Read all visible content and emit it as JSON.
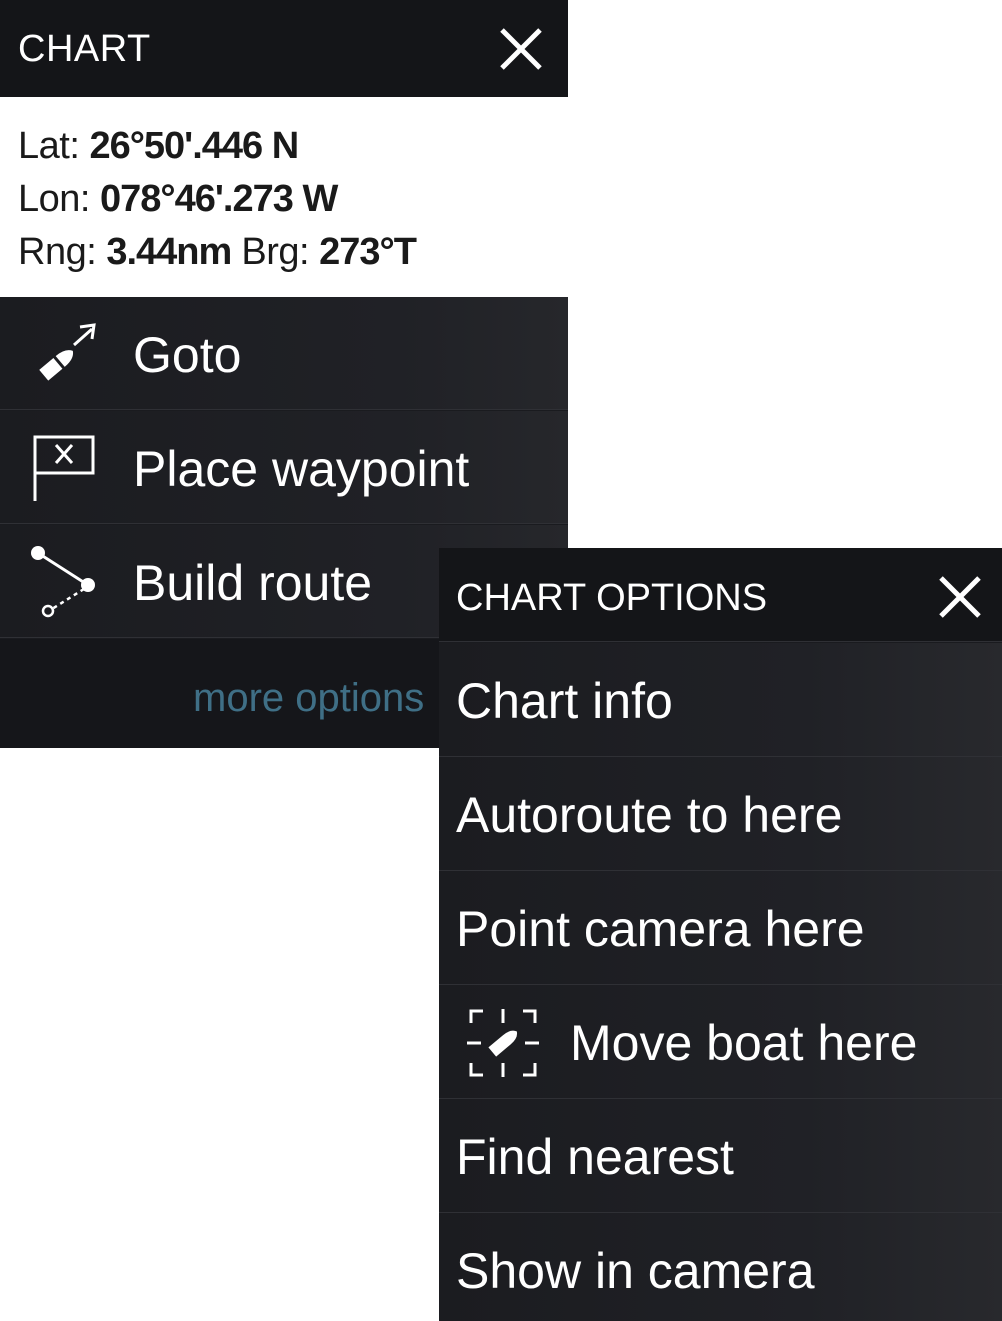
{
  "chart_menu": {
    "title": "CHART",
    "close_icon": "close-icon",
    "coords": {
      "lat_label": "Lat:",
      "lat_value": "26°50'.446 N",
      "lon_label": "Lon:",
      "lon_value": "078°46'.273 W",
      "rng_label": "Rng:",
      "rng_value": "3.44nm",
      "brg_label": "Brg:",
      "brg_value": "273°T"
    },
    "items": [
      {
        "label": "Goto",
        "icon": "goto-icon"
      },
      {
        "label": "Place waypoint",
        "icon": "waypoint-flag-icon"
      },
      {
        "label": "Build route",
        "icon": "route-icon"
      }
    ],
    "more_options": "more options"
  },
  "chart_options": {
    "title": "CHART OPTIONS",
    "close_icon": "close-icon",
    "items": [
      {
        "label": "Chart info"
      },
      {
        "label": "Autoroute to here"
      },
      {
        "label": "Point camera here"
      },
      {
        "label": "Move boat here",
        "icon": "move-boat-icon"
      },
      {
        "label": "Find nearest"
      },
      {
        "label": "Show in camera"
      }
    ]
  },
  "colors": {
    "header_bg": "#141518",
    "panel_bg": "#1a1b1f",
    "text_light": "#ffffff",
    "text_dark": "#1a1a1a",
    "link_blue": "#3f6f86"
  }
}
